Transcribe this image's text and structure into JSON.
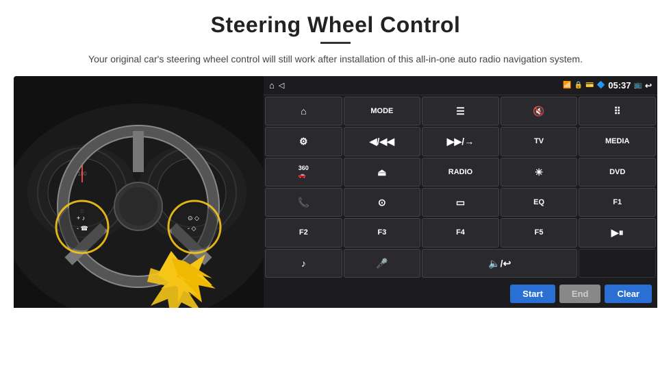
{
  "page": {
    "title": "Steering Wheel Control",
    "subtitle": "Your original car's steering wheel control will still work after installation of this all-in-one auto radio navigation system.",
    "divider": true
  },
  "status_bar": {
    "left_icons": [
      "home-icon",
      "arrow-icon"
    ],
    "wifi_icon": "wifi",
    "lock_icon": "lock",
    "card_icon": "sd-card",
    "bt_icon": "bluetooth",
    "time": "05:37",
    "screen_icon": "screen",
    "back_icon": "back"
  },
  "buttons": [
    {
      "id": "b1",
      "label": "▲",
      "icon": true,
      "row": 1,
      "col": 1
    },
    {
      "id": "b2",
      "label": "MODE",
      "row": 1,
      "col": 2
    },
    {
      "id": "b3",
      "label": "≡",
      "icon": true,
      "row": 1,
      "col": 3
    },
    {
      "id": "b4",
      "label": "🔇",
      "row": 1,
      "col": 4
    },
    {
      "id": "b5",
      "label": "⠿",
      "row": 1,
      "col": 5
    },
    {
      "id": "b6",
      "label": "⚙",
      "row": 2,
      "col": 1
    },
    {
      "id": "b7",
      "label": "◀/◀◀",
      "row": 2,
      "col": 2
    },
    {
      "id": "b8",
      "label": "▶▶/→",
      "row": 2,
      "col": 3
    },
    {
      "id": "b9",
      "label": "TV",
      "row": 2,
      "col": 4
    },
    {
      "id": "b10",
      "label": "MEDIA",
      "row": 2,
      "col": 5
    },
    {
      "id": "b11",
      "label": "360",
      "row": 3,
      "col": 1
    },
    {
      "id": "b12",
      "label": "▲",
      "row": 3,
      "col": 2
    },
    {
      "id": "b13",
      "label": "RADIO",
      "row": 3,
      "col": 3
    },
    {
      "id": "b14",
      "label": "☀",
      "row": 3,
      "col": 4
    },
    {
      "id": "b15",
      "label": "DVD",
      "row": 3,
      "col": 5
    },
    {
      "id": "b16",
      "label": "📞",
      "row": 4,
      "col": 1
    },
    {
      "id": "b17",
      "label": "◎",
      "row": 4,
      "col": 2
    },
    {
      "id": "b18",
      "label": "▭",
      "row": 4,
      "col": 3
    },
    {
      "id": "b19",
      "label": "EQ",
      "row": 4,
      "col": 4
    },
    {
      "id": "b20",
      "label": "F1",
      "row": 4,
      "col": 5
    },
    {
      "id": "b21",
      "label": "F2",
      "row": 5,
      "col": 1
    },
    {
      "id": "b22",
      "label": "F3",
      "row": 5,
      "col": 2
    },
    {
      "id": "b23",
      "label": "F4",
      "row": 5,
      "col": 3
    },
    {
      "id": "b24",
      "label": "F5",
      "row": 5,
      "col": 4
    },
    {
      "id": "b25",
      "label": "▶⏸",
      "row": 5,
      "col": 5
    },
    {
      "id": "b26",
      "label": "♪",
      "row": 6,
      "col": 1
    },
    {
      "id": "b27",
      "label": "🎤",
      "row": 6,
      "col": 2
    },
    {
      "id": "b28",
      "label": "🔈/↩",
      "span": 2,
      "row": 6,
      "col": 3
    }
  ],
  "bottom_buttons": {
    "start": "Start",
    "end": "End",
    "clear": "Clear"
  },
  "colors": {
    "accent_blue": "#2a6fd4",
    "panel_bg": "#1c1c1e",
    "btn_bg": "#2a2a2e",
    "btn_border": "#444444",
    "disabled_gray": "#888888"
  }
}
